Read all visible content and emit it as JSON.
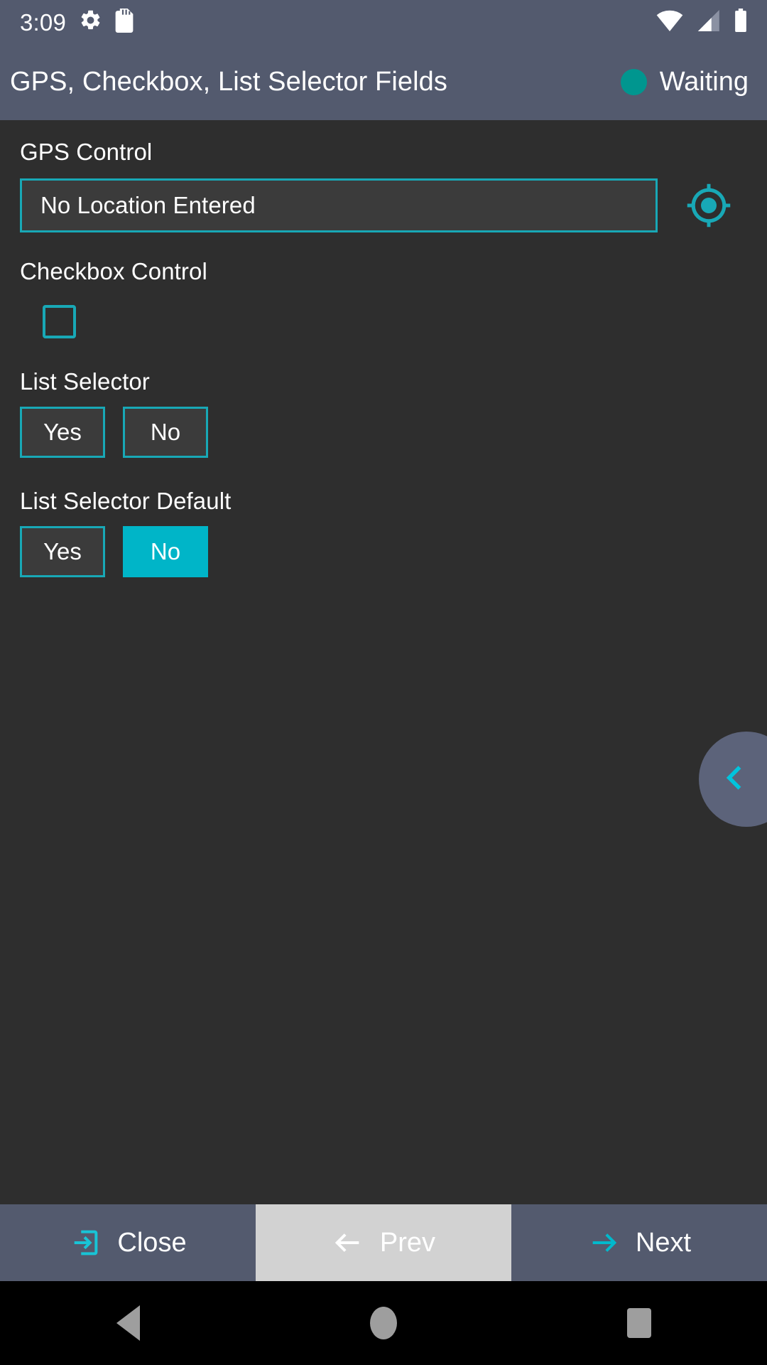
{
  "status_bar": {
    "time": "3:09",
    "icons": [
      "gear-icon",
      "sd-card-icon",
      "wifi-icon",
      "cellular-signal-icon",
      "battery-icon"
    ]
  },
  "header": {
    "title": "GPS, Checkbox, List Selector Fields",
    "status_label": "Waiting",
    "status_color": "#00968f"
  },
  "theme": {
    "accent": "#18a8b6",
    "accent_fill": "#00b5c8",
    "header_bg": "#535a6e",
    "content_bg": "#2e2e2e",
    "field_bg": "#3b3b3b",
    "pressed_bg": "#d2d2d2"
  },
  "form": {
    "gps": {
      "label": "GPS Control",
      "value": "No Location Entered",
      "placeholder": "No Location Entered",
      "icon": "my-location-icon"
    },
    "checkbox": {
      "label": "Checkbox Control",
      "checked": false
    },
    "list_selector": {
      "label": "List Selector",
      "options": [
        {
          "label": "Yes",
          "selected": false
        },
        {
          "label": "No",
          "selected": false
        }
      ]
    },
    "list_selector_default": {
      "label": "List Selector Default",
      "options": [
        {
          "label": "Yes",
          "selected": false
        },
        {
          "label": "No",
          "selected": true
        }
      ]
    }
  },
  "drawer": {
    "icon": "chevron-left-icon"
  },
  "action_bar": {
    "buttons": [
      {
        "label": "Close",
        "icon": "exit-icon",
        "pressed": false
      },
      {
        "label": "Prev",
        "icon": "arrow-left-icon",
        "pressed": true
      },
      {
        "label": "Next",
        "icon": "arrow-right-icon",
        "pressed": false
      }
    ]
  },
  "nav_bar": {
    "buttons": [
      "back-icon",
      "home-icon",
      "recents-icon"
    ]
  }
}
